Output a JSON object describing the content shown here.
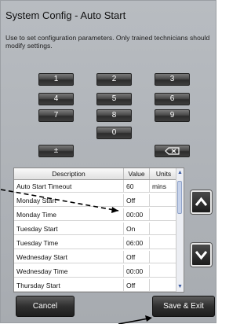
{
  "header": {
    "title": "System Config - Auto Start",
    "description": "Use to set configuration parameters. Only trained technicians should modify settings."
  },
  "keypad": {
    "keys": [
      "1",
      "2",
      "3",
      "4",
      "5",
      "6",
      "7",
      "8",
      "9",
      "0"
    ],
    "plusminus": "±",
    "backspace_icon": "backspace-icon"
  },
  "table": {
    "columns": [
      "Description",
      "Value",
      "Units"
    ],
    "rows": [
      {
        "description": "Auto Start Timeout",
        "value": "60",
        "units": "mins"
      },
      {
        "description": "Monday Start",
        "value": "Off",
        "units": ""
      },
      {
        "description": "Monday Time",
        "value": "00:00",
        "units": ""
      },
      {
        "description": "Tuesday Start",
        "value": "On",
        "units": ""
      },
      {
        "description": "Tuesday Time",
        "value": "06:00",
        "units": ""
      },
      {
        "description": "Wednesday Start",
        "value": "Off",
        "units": ""
      },
      {
        "description": "Wednesday Time",
        "value": "00:00",
        "units": ""
      },
      {
        "description": "Thursday Start",
        "value": "Off",
        "units": ""
      }
    ]
  },
  "scroll": {
    "up_icon": "chevron-up-icon",
    "down_icon": "chevron-down-icon"
  },
  "actions": {
    "cancel_label": "Cancel",
    "save_label": "Save & Exit"
  },
  "colors": {
    "panel": "#b0b4b9",
    "button_dark": "#2c2c2c",
    "annotation": "#000000"
  }
}
